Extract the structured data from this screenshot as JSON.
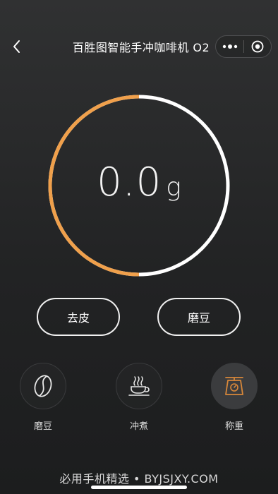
{
  "header": {
    "title": "百胜图智能手冲咖啡机 O2"
  },
  "scale": {
    "value": "0.0",
    "unit": "g",
    "progress": 0.5,
    "colors": {
      "progress": "#f0a04b",
      "track": "#ffffff"
    }
  },
  "actions": {
    "tare_label": "去皮",
    "grind_label": "磨豆"
  },
  "modes": [
    {
      "label": "磨豆",
      "icon": "coffee-bean-icon",
      "active": false
    },
    {
      "label": "冲煮",
      "icon": "coffee-cup-icon",
      "active": false
    },
    {
      "label": "称重",
      "icon": "scale-icon",
      "active": true,
      "accent": "#d9883a"
    }
  ],
  "watermark": "必用手机精选 • BYJSJXY.COM"
}
